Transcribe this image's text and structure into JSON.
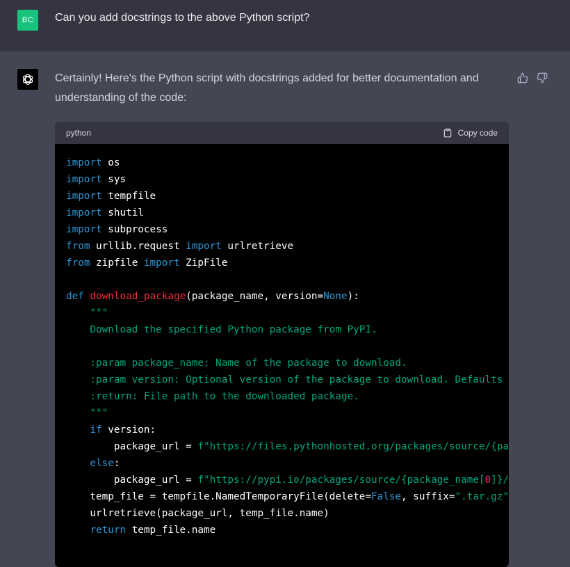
{
  "colors": {
    "user_avatar_bg": "#19c37d",
    "keyword": "#2e95d3",
    "function": "#f22c3d",
    "string": "#00a67d",
    "number": "#df3079"
  },
  "user": {
    "avatar_initials": "BC",
    "message": "Can you add docstrings to the above Python script?"
  },
  "assistant": {
    "avatar_icon": "openai-logo-icon",
    "message": "Certainly! Here's the Python script with docstrings added for better documentation and understanding of the code:",
    "feedback": {
      "thumbs_up_icon": "thumbs-up-icon",
      "thumbs_down_icon": "thumbs-down-icon"
    }
  },
  "code_block": {
    "language": "python",
    "copy_label": "Copy code",
    "copy_icon": "clipboard-icon",
    "lines": [
      [
        {
          "t": "kw",
          "v": "import"
        },
        {
          "t": "plain",
          "v": " os"
        }
      ],
      [
        {
          "t": "kw",
          "v": "import"
        },
        {
          "t": "plain",
          "v": " sys"
        }
      ],
      [
        {
          "t": "kw",
          "v": "import"
        },
        {
          "t": "plain",
          "v": " tempfile"
        }
      ],
      [
        {
          "t": "kw",
          "v": "import"
        },
        {
          "t": "plain",
          "v": " shutil"
        }
      ],
      [
        {
          "t": "kw",
          "v": "import"
        },
        {
          "t": "plain",
          "v": " subprocess"
        }
      ],
      [
        {
          "t": "kw",
          "v": "from"
        },
        {
          "t": "plain",
          "v": " urllib.request "
        },
        {
          "t": "kw",
          "v": "import"
        },
        {
          "t": "plain",
          "v": " urlretrieve"
        }
      ],
      [
        {
          "t": "kw",
          "v": "from"
        },
        {
          "t": "plain",
          "v": " zipfile "
        },
        {
          "t": "kw",
          "v": "import"
        },
        {
          "t": "plain",
          "v": " ZipFile"
        }
      ],
      [],
      [
        {
          "t": "kw",
          "v": "def"
        },
        {
          "t": "plain",
          "v": " "
        },
        {
          "t": "fn",
          "v": "download_package"
        },
        {
          "t": "plain",
          "v": "(package_name, version="
        },
        {
          "t": "kw",
          "v": "None"
        },
        {
          "t": "plain",
          "v": "):"
        }
      ],
      [
        {
          "t": "str",
          "v": "    \"\"\""
        }
      ],
      [
        {
          "t": "str",
          "v": "    Download the specified Python package from PyPI."
        }
      ],
      [],
      [
        {
          "t": "str",
          "v": "    :param package_name: Name of the package to download."
        }
      ],
      [
        {
          "t": "str",
          "v": "    :param version: Optional version of the package to download. Defaults to"
        }
      ],
      [
        {
          "t": "str",
          "v": "    :return: File path to the downloaded package."
        }
      ],
      [
        {
          "t": "str",
          "v": "    \"\"\""
        }
      ],
      [
        {
          "t": "plain",
          "v": "    "
        },
        {
          "t": "kw",
          "v": "if"
        },
        {
          "t": "plain",
          "v": " version:"
        }
      ],
      [
        {
          "t": "plain",
          "v": "        package_url = "
        },
        {
          "t": "str",
          "v": "f\"https://files.pythonhosted.org/packages/source/{pack"
        }
      ],
      [
        {
          "t": "plain",
          "v": "    "
        },
        {
          "t": "kw",
          "v": "else"
        },
        {
          "t": "plain",
          "v": ":"
        }
      ],
      [
        {
          "t": "plain",
          "v": "        package_url = "
        },
        {
          "t": "str",
          "v": "f\"https://pypi.io/packages/source/{package_name["
        },
        {
          "t": "num",
          "v": "0"
        },
        {
          "t": "str",
          "v": "]}/{p"
        }
      ],
      [
        {
          "t": "plain",
          "v": "    temp_file = tempfile.NamedTemporaryFile(delete="
        },
        {
          "t": "kw",
          "v": "False"
        },
        {
          "t": "plain",
          "v": ", suffix="
        },
        {
          "t": "str",
          "v": "\".tar.gz\""
        },
        {
          "t": "plain",
          "v": ")"
        }
      ],
      [
        {
          "t": "plain",
          "v": "    urlretrieve(package_url, temp_file.name)"
        }
      ],
      [
        {
          "t": "plain",
          "v": "    "
        },
        {
          "t": "kw",
          "v": "return"
        },
        {
          "t": "plain",
          "v": " temp_file.name"
        }
      ]
    ]
  }
}
